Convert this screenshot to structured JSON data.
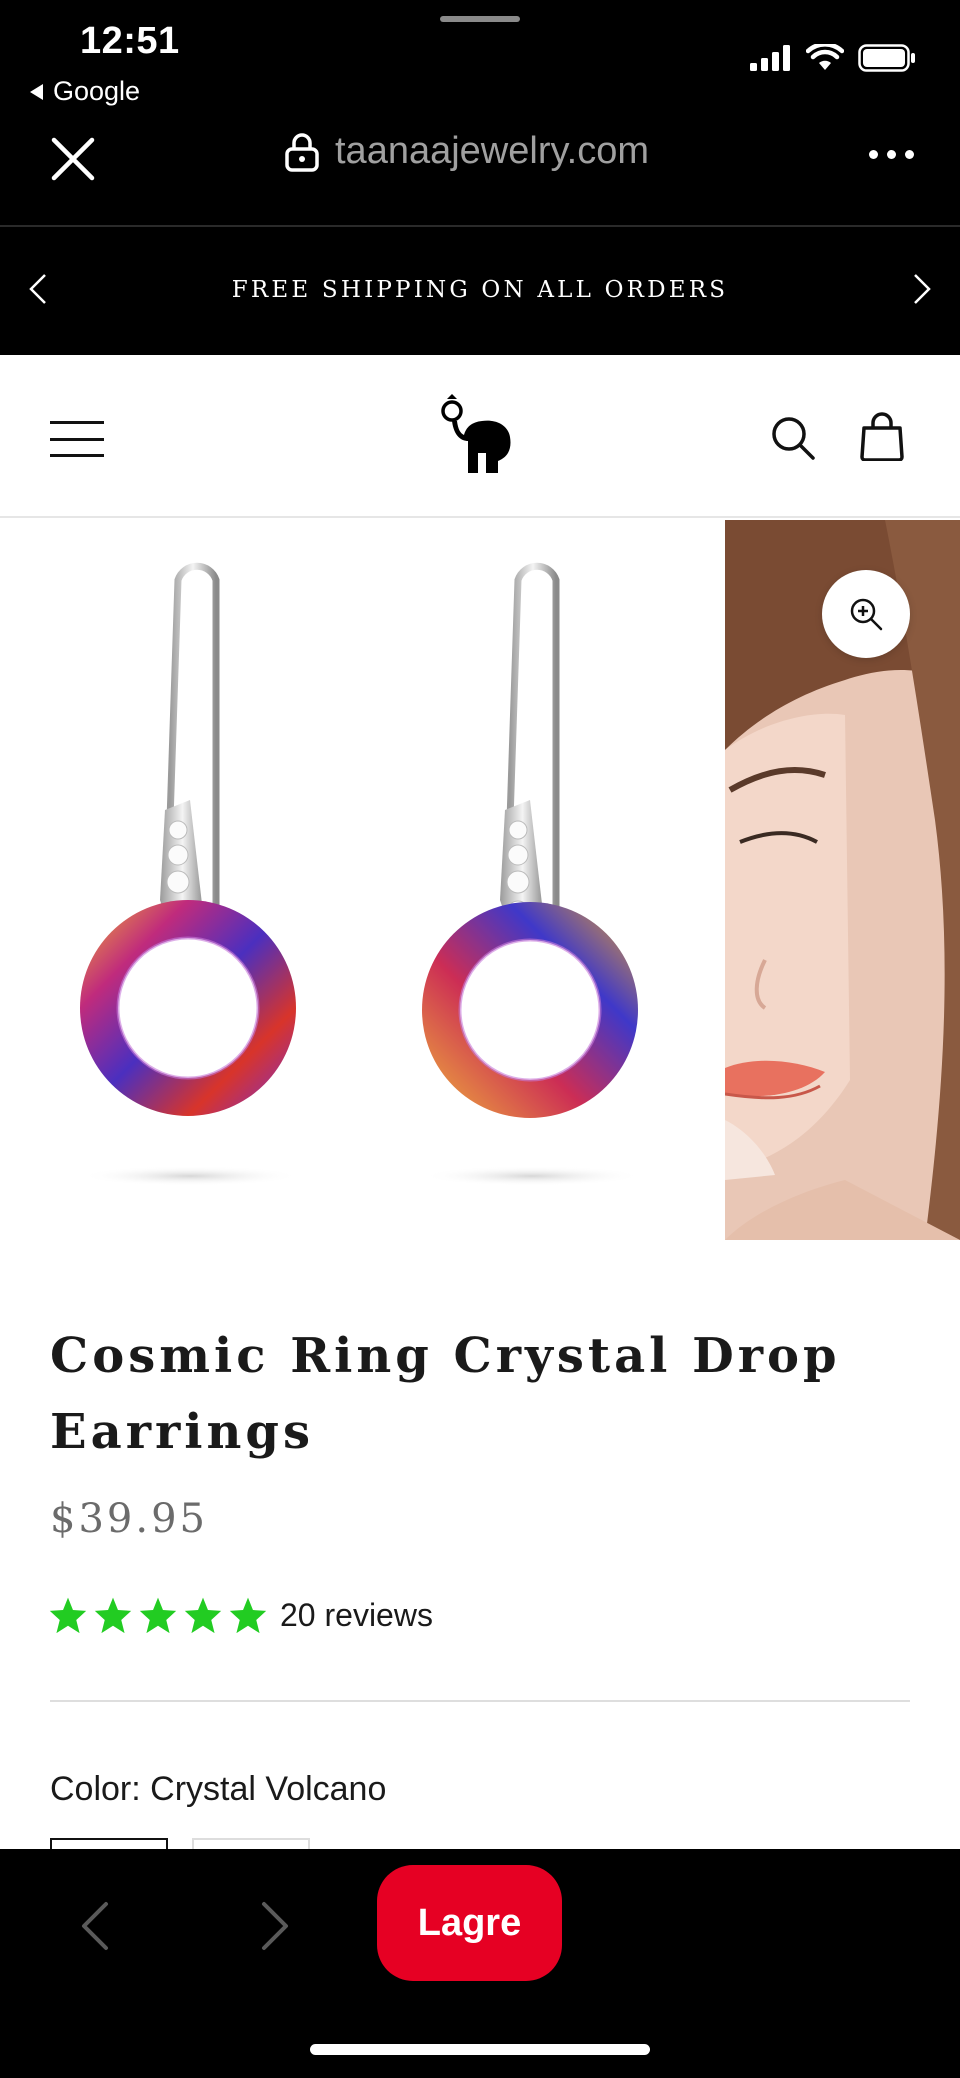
{
  "status_bar": {
    "time": "12:51",
    "back_app": "Google",
    "icons": [
      "signal-icon",
      "wifi-icon",
      "battery-icon"
    ]
  },
  "browser": {
    "url": "taanaajewelry.com",
    "close_icon": "close-icon",
    "lock_icon": "lock-icon",
    "more_icon": "more-icon"
  },
  "announcement": {
    "text": "FREE SHIPPING ON ALL ORDERS"
  },
  "header": {
    "menu_icon": "hamburger-icon",
    "logo": "elephant-logo",
    "search_icon": "search-icon",
    "cart_icon": "bag-icon"
  },
  "product": {
    "title": "Cosmic Ring Crystal Drop Earrings",
    "price": "$39.95",
    "rating": 5,
    "reviews": "20 reviews",
    "color_label": "Color:",
    "color_value": "Crystal Volcano"
  },
  "toolbar": {
    "save_label": "Lagre"
  },
  "colors": {
    "star": "#22cc22",
    "save_button": "#e60023"
  }
}
